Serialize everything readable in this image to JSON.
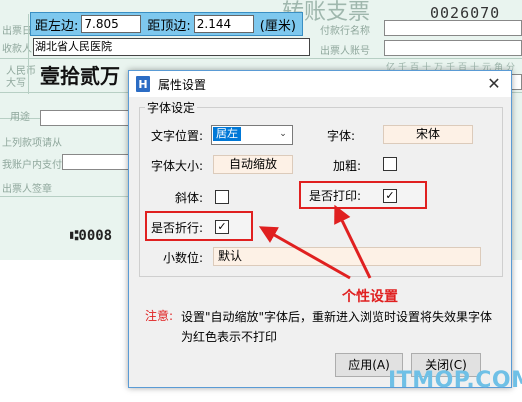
{
  "cheque": {
    "title": "转账支票",
    "serial": "0026070",
    "issue_date_label": "出票日期",
    "payee_label": "收款人",
    "payee_value": "湖北省人民医院",
    "bank_name_label": "付款行名称",
    "drawer_account_label": "出票人账号",
    "rmb_label": "人民币",
    "rmb_upper_label": "大写",
    "amount_words": "壹拾贰万",
    "purpose_label": "用途",
    "above_amount_label": "上列款项请从",
    "account_label": "我账户内支付",
    "drawer_sign_label": "出票人签章",
    "micr": "⑆0008",
    "digit_headers": [
      "亿",
      "千",
      "百",
      "十",
      "万",
      "千",
      "百",
      "十",
      "元",
      "角",
      "分"
    ]
  },
  "margin_bar": {
    "left_label": "距左边:",
    "left_value": "7.805",
    "top_label": "距顶边:",
    "top_value": "2.144",
    "unit": "(厘米)"
  },
  "dialog": {
    "title": "属性设置",
    "close_glyph": "✕",
    "group_title": "字体设定",
    "position_label": "文字位置:",
    "position_value": "居左",
    "font_label": "字体:",
    "font_value": "宋体",
    "size_label": "字体大小:",
    "size_value": "自动缩放",
    "bold_label": "加粗:",
    "bold_checked": false,
    "italic_label": "斜体:",
    "italic_checked": false,
    "print_label": "是否打印:",
    "print_checked": true,
    "wrap_label": "是否折行:",
    "wrap_checked": true,
    "decimal_label": "小数位:",
    "decimal_value": "默认",
    "note_label": "注意:",
    "note_text": "设置\"自动缩放\"字体后，重新进入浏览时设置将失效果字体为红色表示不打印",
    "apply_button": "应用(A)",
    "close_button": "关闭(C)"
  },
  "annotation": {
    "callout": "个性设置",
    "color": "#e02020"
  },
  "watermark": "ITMOP.COM",
  "check_glyph": "✓"
}
